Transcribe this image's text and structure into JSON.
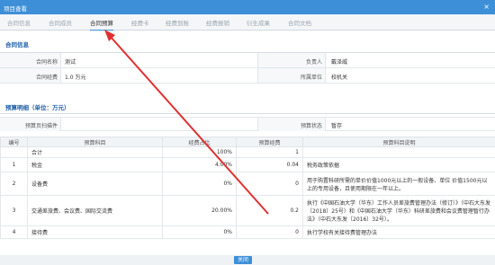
{
  "window": {
    "title": "项目查看",
    "close_glyph": "×"
  },
  "tabs": [
    "合同信息",
    "合同成员",
    "合同预算",
    "经费卡",
    "经费到账",
    "经费报销",
    "衍生成果",
    "合同文档"
  ],
  "contract_info": {
    "section_title": "合同信息",
    "name_label": "合同名称",
    "name_value": "测试",
    "leader_label": "负责人",
    "leader_value": "戴泽威",
    "funding_label": "合同经费",
    "funding_value": "1.0 万元",
    "unit_label": "所属单位",
    "unit_value": "校机关"
  },
  "budget": {
    "section_title": "预算明细（单位：万元）",
    "attachment_label": "预算页扫描件",
    "status_label": "预算状态",
    "status_value": "暂存",
    "headers": [
      "编号",
      "预算科目",
      "经费占比",
      "预算经费",
      "预算科目说明"
    ],
    "rows": [
      {
        "no": "",
        "item": "合计",
        "ratio": "100%",
        "amount": "1",
        "desc": ""
      },
      {
        "no": "1",
        "item": "税金",
        "ratio": "4.00%",
        "amount": "0.04",
        "desc": "税务政策依据"
      },
      {
        "no": "2",
        "item": "设备费",
        "ratio": "0%",
        "amount": "0",
        "desc": "用于购置科研所需的单价价值1000元以上的一般设备、单位 价值1500元以上的专用设备，且使用期限在一年以上。"
      },
      {
        "no": "3",
        "item": "交通差旅费、会议费、国际交流费",
        "ratio": "20.00%",
        "amount": "0.2",
        "desc": "执行《中国石油大学（华东）工作人员差旅费管理办法（修订）》（中石大东发〔2018〕25号）和《中国石油大学（华东）科研差旅费和会议费管理暂行办法》（中石大东发〔2016〕32号）。"
      },
      {
        "no": "4",
        "item": "接待费",
        "ratio": "0%",
        "amount": "0",
        "desc": "执行学校有关接待费管理办法"
      }
    ]
  },
  "footer": {
    "close_label": "关闭"
  },
  "colors": {
    "accent": "#3d8fd8",
    "arrow": "#e03131"
  }
}
